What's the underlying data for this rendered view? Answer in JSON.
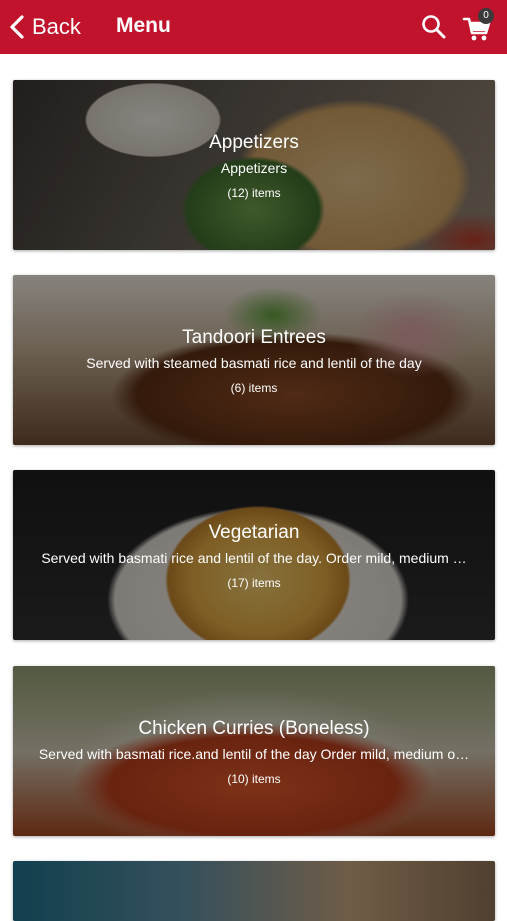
{
  "header": {
    "back_label": "Back",
    "title": "Menu",
    "cart_count": "0",
    "icons": {
      "back": "chevron-left-icon",
      "search": "search-icon",
      "cart": "cart-icon"
    },
    "color": "#c1132b"
  },
  "categories": [
    {
      "name": "Appetizers",
      "description": "Appetizers",
      "count": "(12) items"
    },
    {
      "name": "Tandoori Entrees",
      "description": "Served with steamed basmati rice and lentil of the day",
      "count": "(6) items"
    },
    {
      "name": "Vegetarian",
      "description": "Served with basmati rice and lentil of the day. Order mild, medium …",
      "count": "(17) items"
    },
    {
      "name": "Chicken Curries (Boneless)",
      "description": "Served with basmati rice.and lentil of the day Order mild, medium o…",
      "count": "(10) items"
    }
  ]
}
